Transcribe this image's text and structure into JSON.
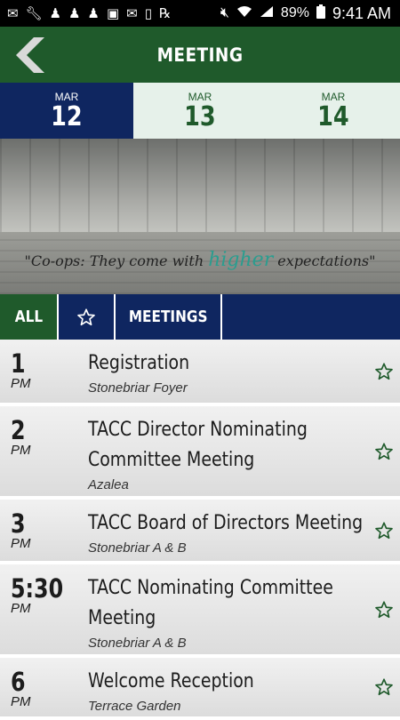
{
  "status_bar": {
    "battery_percent": "89%",
    "time": "9:41 AM",
    "icons": [
      "message-icon",
      "wrench-icon",
      "chess-pawn-icon",
      "chess-pawn-icon",
      "chess-pawn-icon",
      "image-icon",
      "mail-icon",
      "tablet-icon",
      "prescription-icon",
      "mute-icon",
      "wifi-icon",
      "signal-icon",
      "battery-icon"
    ]
  },
  "header": {
    "title": "MEETING"
  },
  "dates": [
    {
      "month": "MAR",
      "day": "12",
      "active": true
    },
    {
      "month": "MAR",
      "day": "13",
      "active": false
    },
    {
      "month": "MAR",
      "day": "14",
      "active": false
    }
  ],
  "banner": {
    "quote_before": "\"Co-ops: They come with ",
    "quote_accent": "higher",
    "quote_after": " expectations\""
  },
  "filters": {
    "all_label": "ALL",
    "favorites_icon": "star-outline-icon",
    "meetings_label": "MEETINGS"
  },
  "events": [
    {
      "time": "1",
      "ampm": "PM",
      "title": "Registration",
      "location": "Stonebriar Foyer"
    },
    {
      "time": "2",
      "ampm": "PM",
      "title": "TACC Director Nominating Committee Meeting",
      "location": "Azalea"
    },
    {
      "time": "3",
      "ampm": "PM",
      "title": "TACC Board of Directors Meeting",
      "location": "Stonebriar A & B"
    },
    {
      "time": "5:30",
      "ampm": "PM",
      "title": "TACC Nominating Committee Meeting",
      "location": "Stonebriar A & B"
    },
    {
      "time": "6",
      "ampm": "PM",
      "title": "Welcome Reception",
      "location": "Terrace Garden"
    }
  ],
  "colors": {
    "header_green": "#1f5a2b",
    "navy": "#0f2660",
    "date_inactive_bg": "#e6f1ea",
    "accent_teal": "#2a9d8f"
  }
}
